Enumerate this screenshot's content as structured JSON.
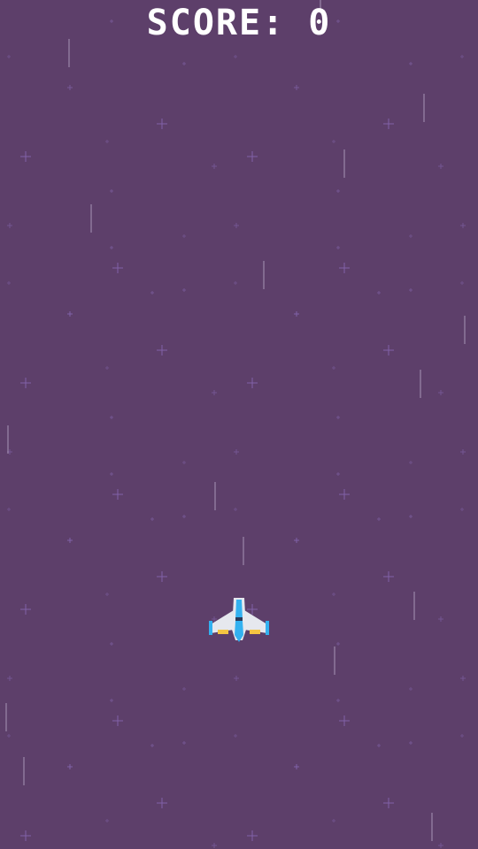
{
  "hud": {
    "score_text": "SCORE: 0",
    "score_value": 0
  },
  "colors": {
    "background": "#5d3f6a",
    "star": "#8a6bb8",
    "streak": "#c9b8d6",
    "hud_text": "#ffffff",
    "ship_body": "#e6e8ee",
    "ship_accent": "#33b1f0",
    "ship_engine": "#f5c542"
  },
  "icons": {
    "player": "spaceship-icon",
    "star": "sparkle-star-icon",
    "streak": "speed-streak-line"
  }
}
